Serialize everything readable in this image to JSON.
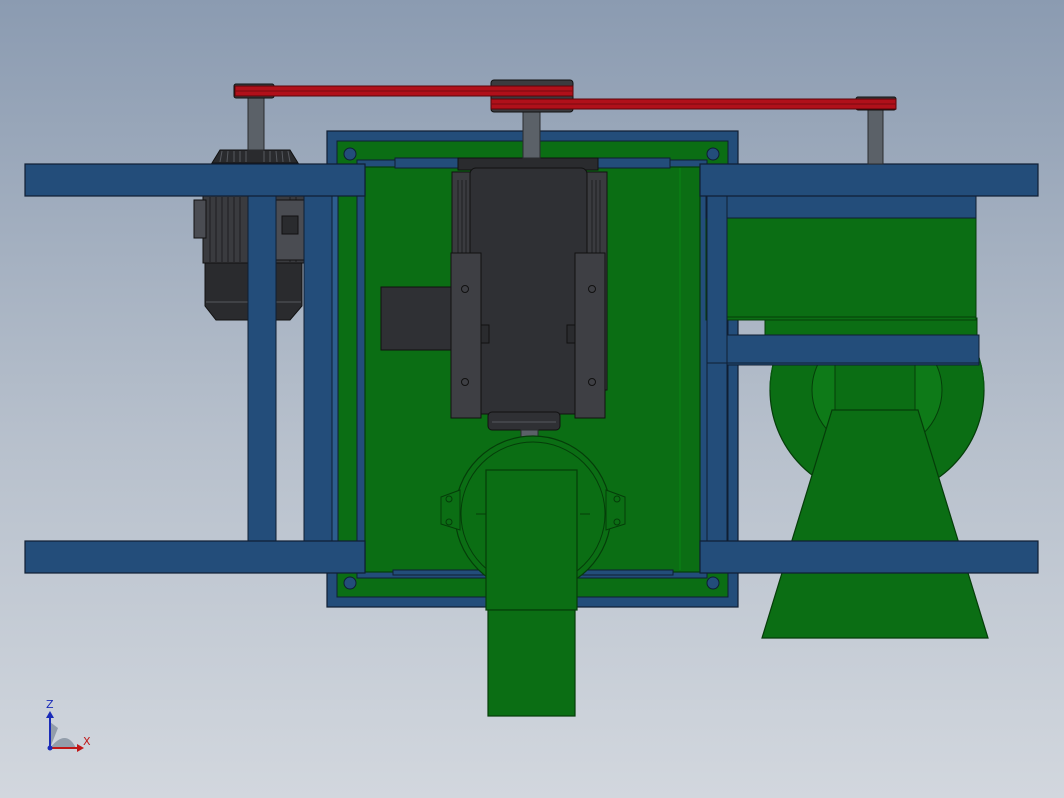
{
  "scene": {
    "name": "",
    "view": "front"
  },
  "triad": {
    "z_label": "Z",
    "x_label": "X",
    "z_color": "#1a2bb8",
    "x_color": "#c01818"
  },
  "colors": {
    "frame_blue": "#234d7a",
    "frame_edge": "#0f1e33",
    "housing_green": "#0b6e14",
    "housing_green_dark": "#075a0e",
    "motor_dark": "#3a3b3f",
    "motor_mid": "#2a2b2e",
    "shaft_grey": "#5b6168",
    "belt_red": "#b0101a",
    "background_top": "#8b9bb1",
    "background_bottom": "#d2d7de"
  },
  "components": [
    {
      "id": "main-frame",
      "label": ""
    },
    {
      "id": "drive-motor",
      "label": ""
    },
    {
      "id": "gear-reducer",
      "label": ""
    },
    {
      "id": "belt-drive",
      "label": ""
    },
    {
      "id": "blower-fan",
      "label": ""
    },
    {
      "id": "discharge-chute",
      "label": ""
    }
  ]
}
